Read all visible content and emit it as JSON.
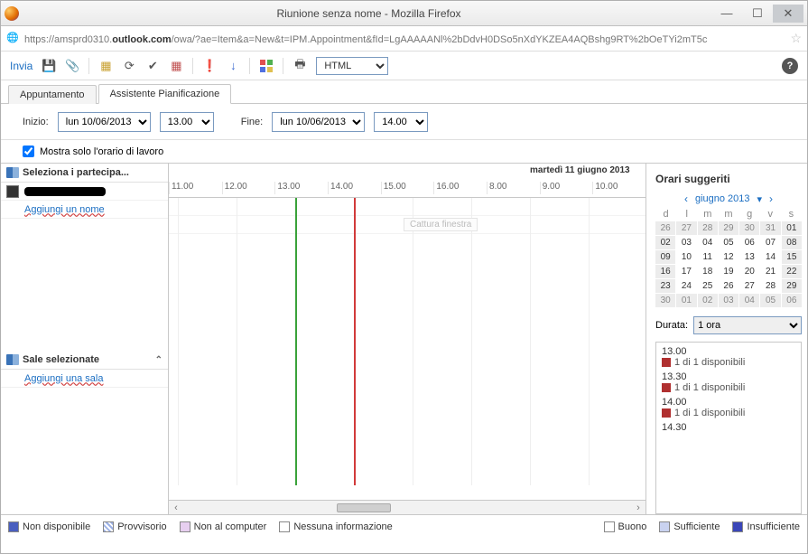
{
  "window": {
    "title": "Riunione senza nome - Mozilla Firefox",
    "url_pre": "https://amsprd0310.",
    "url_bold": "outlook.com",
    "url_post": "/owa/?ae=Item&a=New&t=IPM.Appointment&fId=LgAAAAANl%2bDdvH0DSo5nXdYKZEA4AQBshg9RT%2bOeTYi2mT5c"
  },
  "toolbar": {
    "send": "Invia",
    "format_select": "HTML"
  },
  "tabs": {
    "t1": "Appuntamento",
    "t2": "Assistente Pianificazione"
  },
  "daterow": {
    "start_label": "Inizio:",
    "start_date": "lun 10/06/2013",
    "start_time": "13.00",
    "end_label": "Fine:",
    "end_date": "lun 10/06/2013",
    "end_time": "14.00"
  },
  "workhours_label": "Mostra solo l'orario di lavoro",
  "participants": {
    "header": "Seleziona i partecipa...",
    "add": "Aggiungi un nome"
  },
  "rooms": {
    "header": "Sale selezionate",
    "add": "Aggiungi una sala"
  },
  "timeline": {
    "day2_label": "martedì 11 giugno 2013",
    "hours": [
      "11.00",
      "12.00",
      "13.00",
      "14.00",
      "15.00",
      "16.00",
      "8.00",
      "9.00",
      "10.00"
    ],
    "hint": "Cattura finestra"
  },
  "rightpanel": {
    "title": "Orari suggeriti",
    "month": "giugno 2013",
    "dow": [
      "d",
      "l",
      "m",
      "m",
      "g",
      "v",
      "s"
    ],
    "days": [
      "26",
      "27",
      "28",
      "29",
      "30",
      "31",
      "01",
      "02",
      "03",
      "04",
      "05",
      "06",
      "07",
      "08",
      "09",
      "10",
      "11",
      "12",
      "13",
      "14",
      "15",
      "16",
      "17",
      "18",
      "19",
      "20",
      "21",
      "22",
      "23",
      "24",
      "25",
      "26",
      "27",
      "28",
      "29",
      "30",
      "01",
      "02",
      "03",
      "04",
      "05",
      "06"
    ],
    "dur_label": "Durata:",
    "dur_value": "1 ora",
    "suggestions": [
      {
        "time": "13.00",
        "avail": "1 di 1 disponibili"
      },
      {
        "time": "13.30",
        "avail": "1 di 1 disponibili"
      },
      {
        "time": "14.00",
        "avail": "1 di 1 disponibili"
      },
      {
        "time": "14.30",
        "avail": ""
      }
    ]
  },
  "legend": {
    "l1": "Non disponibile",
    "l2": "Provvisorio",
    "l3": "Non al computer",
    "l4": "Nessuna informazione",
    "r1": "Buono",
    "r2": "Sufficiente",
    "r3": "Insufficiente"
  }
}
